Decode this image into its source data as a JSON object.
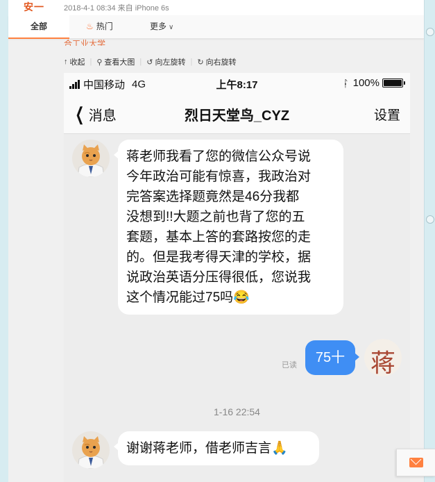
{
  "feed": {
    "avatar_text": "安一",
    "meta": "2018-4-1 08:34 来自 iPhone 6s"
  },
  "tabs": [
    {
      "label": "全部"
    },
    {
      "label": "热门"
    },
    {
      "label": "更多"
    }
  ],
  "origin_line": "合工业大学",
  "toolbar": {
    "collapse": "收起",
    "view_large": "查看大图",
    "rotate_left": "向左旋转",
    "rotate_right": "向右旋转",
    "separator": "|"
  },
  "phone": {
    "status": {
      "carrier": "中国移动",
      "network": "4G",
      "time": "上午8:17",
      "battery_pct": "100%",
      "battery_level": 1.0
    },
    "nav": {
      "back": "消息",
      "title": "烈日天堂鸟_CYZ",
      "settings": "设置"
    },
    "messages": [
      {
        "lines": [
          "蒋老师我看了您的微信公众号说",
          "今年政治可能有惊喜，我政治对",
          "完答案选择题竟然是46分我都",
          "没想到!!大题之前也背了您的五",
          "套题，基本上答的套路按您的走",
          "的。但是我考得天津的学校，据",
          "说政治英语分压得很低，您说我",
          "这个情况能过75吗😂"
        ]
      },
      {
        "read_label": "已读",
        "text": "75十",
        "stamp_char": "蒋"
      },
      {
        "timestamp": "1-16 22:54"
      },
      {
        "text": "谢谢蒋老师，借老师吉言🙏"
      }
    ]
  },
  "colors": {
    "accent": "#ff8140",
    "bubble_out": "#3f8ef4",
    "feed_red": "#e2571e"
  }
}
